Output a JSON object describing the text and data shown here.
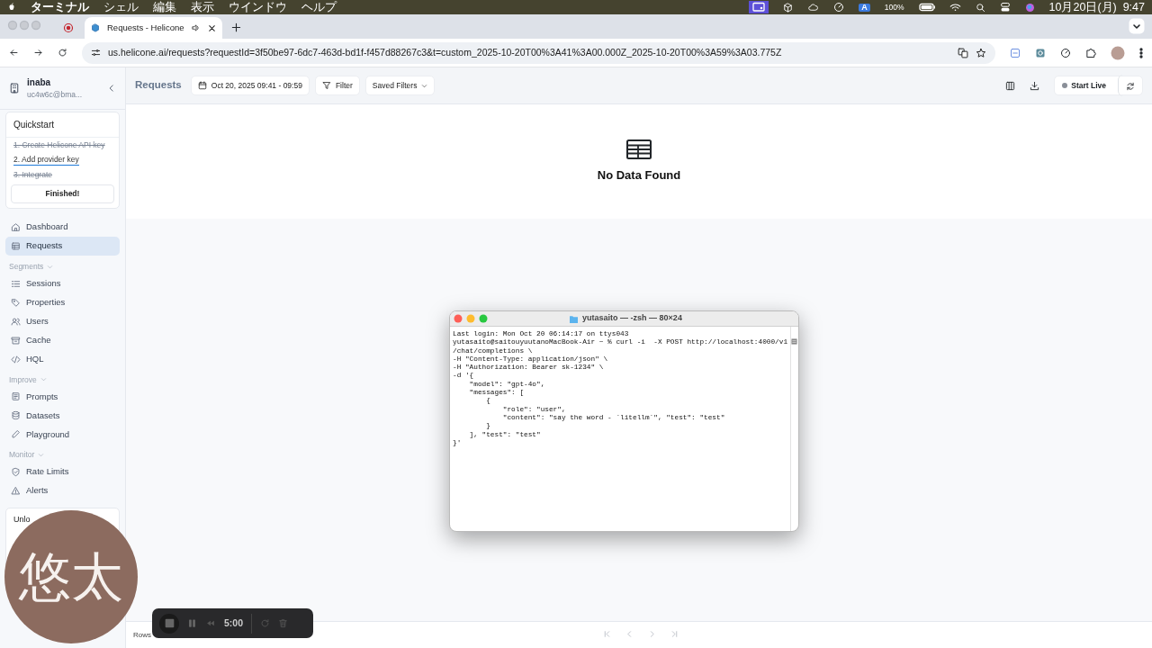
{
  "menubar": {
    "menus": [
      "ターミナル",
      "シェル",
      "編集",
      "表示",
      "ウインドウ",
      "ヘルプ"
    ],
    "input_source": "A",
    "battery": "100%",
    "clock": "10月20日(月)  9:47"
  },
  "browser": {
    "tabs": [
      {
        "title": "Requests - Helicone",
        "selected": true
      }
    ],
    "url": "us.helicone.ai/requests?requestId=3f50be97-6dc7-463d-bd1f-f457d88267c3&t=custom_2025-10-20T00%3A41%3A00.000Z_2025-10-20T00%3A59%3A03.775Z"
  },
  "sidebar": {
    "org": {
      "name": "inaba",
      "email": "uc4w6c@bma..."
    },
    "quickstart": {
      "title": "Quickstart",
      "steps": [
        {
          "label": "1. Create Helicone API key",
          "done": true
        },
        {
          "label": "2. Add provider key",
          "done": false
        },
        {
          "label": "3. Integrate",
          "done": true
        }
      ],
      "button": "Finished!"
    },
    "groups": [
      {
        "items": [
          {
            "label": "Dashboard",
            "selected": false
          },
          {
            "label": "Requests",
            "selected": true
          }
        ]
      },
      {
        "heading": "Segments",
        "items": [
          {
            "label": "Sessions",
            "selected": false
          },
          {
            "label": "Properties",
            "selected": false
          },
          {
            "label": "Users",
            "selected": false
          },
          {
            "label": "Cache",
            "selected": false
          },
          {
            "label": "HQL",
            "selected": false
          }
        ]
      },
      {
        "heading": "Improve",
        "items": [
          {
            "label": "Prompts",
            "selected": false
          },
          {
            "label": "Datasets",
            "selected": false
          },
          {
            "label": "Playground",
            "selected": false
          }
        ]
      },
      {
        "heading": "Monitor",
        "items": [
          {
            "label": "Rate Limits",
            "selected": false
          },
          {
            "label": "Alerts",
            "selected": false
          }
        ]
      }
    ],
    "unlock": {
      "title": "Unlo"
    }
  },
  "header": {
    "title": "Requests",
    "date_range": "Oct 20, 2025 09:41 - 09:59",
    "filter": "Filter",
    "saved_filters": "Saved Filters",
    "live": "Start Live"
  },
  "empty_state": {
    "message": "No Data Found"
  },
  "footer": {
    "rows_label": "Rows"
  },
  "terminal": {
    "title": "yutasaito — -zsh — 80×24",
    "lines": [
      "Last login: Mon Oct 20 06:14:17 on ttys043",
      "yutasaito@saitouyuutanoMacBook-Air ~ % curl -i  -X POST http://localhost:4000/v1",
      "/chat/completions \\",
      "-H \"Content-Type: application/json\" \\",
      "-H \"Authorization: Bearer sk-1234\" \\",
      "-d '{",
      "    \"model\": \"gpt-4o\",",
      "    \"messages\": [",
      "        {",
      "            \"role\": \"user\",",
      "            \"content\": \"say the word - `litellm`\", \"test\": \"test\"",
      "        }",
      "    ], \"test\": \"test\"",
      "}'"
    ]
  },
  "avatar": {
    "text": "悠太"
  },
  "recorder": {
    "time": "5:00"
  }
}
